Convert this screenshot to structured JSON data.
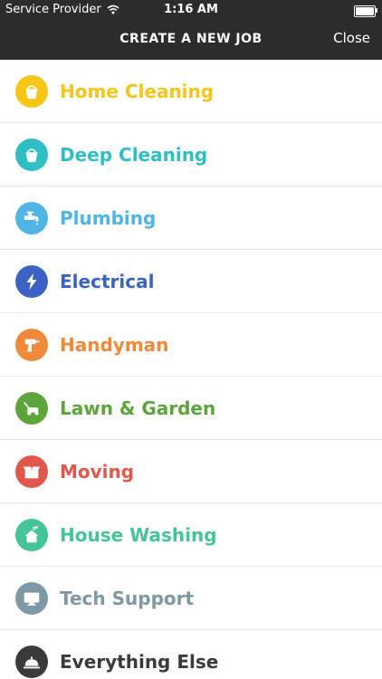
{
  "status_bar": {
    "carrier": "Service Provider",
    "time": "1:16 AM"
  },
  "navigation": {
    "title": "CREATE A NEW JOB",
    "close_label": "Close"
  },
  "jobs": [
    {
      "label": "Home Cleaning",
      "color": "#f5c518",
      "icon": "bucket-icon"
    },
    {
      "label": "Deep Cleaning",
      "color": "#2ebfc4",
      "icon": "bucket-icon"
    },
    {
      "label": "Plumbing",
      "color": "#4fb4e6",
      "icon": "faucet-icon"
    },
    {
      "label": "Electrical",
      "color": "#3c62c4",
      "icon": "lightning-bolt-icon"
    },
    {
      "label": "Handyman",
      "color": "#f08a3a",
      "icon": "drill-icon"
    },
    {
      "label": "Lawn & Garden",
      "color": "#5da43a",
      "icon": "lawn-mower-icon"
    },
    {
      "label": "Moving",
      "color": "#e2574c",
      "icon": "moving-box-icon"
    },
    {
      "label": "House Washing",
      "color": "#45c49a",
      "icon": "house-icon"
    },
    {
      "label": "Tech Support",
      "color": "#7f98a5",
      "icon": "monitor-icon"
    },
    {
      "label": "Everything Else",
      "color": "#3a3a3a",
      "icon": "service-bell-icon"
    }
  ]
}
